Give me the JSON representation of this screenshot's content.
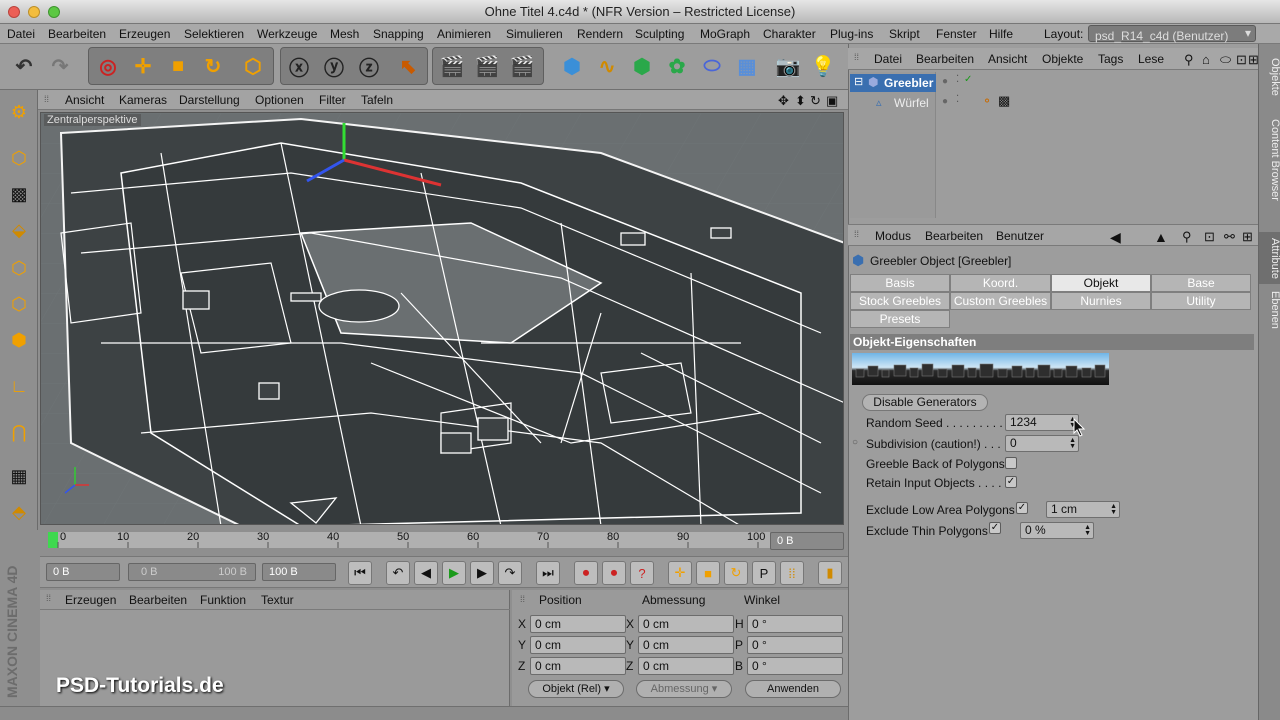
{
  "window": {
    "title": "Ohne Titel 4.c4d * (NFR Version – Restricted License)"
  },
  "menubar": {
    "items": [
      "Datei",
      "Bearbeiten",
      "Erzeugen",
      "Selektieren",
      "Werkzeuge",
      "Mesh",
      "Snapping",
      "Animieren",
      "Simulieren",
      "Rendern",
      "Sculpting",
      "MoGraph",
      "Charakter",
      "Plug-ins",
      "Skript",
      "Fenster",
      "Hilfe"
    ],
    "layout_label": "Layout:",
    "layout_value": "psd_R14_c4d (Benutzer)"
  },
  "viewport": {
    "menu": [
      "Ansicht",
      "Kameras",
      "Darstellung",
      "Optionen",
      "Filter",
      "Tafeln"
    ],
    "label": "Zentralperspektive"
  },
  "timeline": {
    "ticks": [
      "0",
      "10",
      "20",
      "30",
      "40",
      "50",
      "60",
      "70",
      "80",
      "90",
      "100"
    ],
    "current_frame_field": "0 B"
  },
  "transport": {
    "start_field": "0 B",
    "range_start": "0 B",
    "range_end": "100 B",
    "end_field": "100 B"
  },
  "material_panel": {
    "menu": [
      "Erzeugen",
      "Bearbeiten",
      "Funktion",
      "Textur"
    ]
  },
  "coord_panel": {
    "headers": [
      "Position",
      "Abmessung",
      "Winkel"
    ],
    "pos": {
      "x": "0 cm",
      "y": "0 cm",
      "z": "0 cm"
    },
    "size": {
      "x": "0 cm",
      "y": "0 cm",
      "z": "0 cm"
    },
    "rot": {
      "h": "0 °",
      "p": "0 °",
      "b": "0 °"
    },
    "axis_labels": {
      "x": "X",
      "y": "Y",
      "z": "Z",
      "h": "H",
      "p": "P",
      "b": "B"
    },
    "mode_select": "Objekt (Rel)",
    "size_select": "Abmessung",
    "apply_button": "Anwenden"
  },
  "branding": {
    "watermark": "PSD-Tutorials.de",
    "maxon": "MAXON CINEMA 4D"
  },
  "object_manager": {
    "menu": [
      "Datei",
      "Bearbeiten",
      "Ansicht",
      "Objekte",
      "Tags",
      "Lese"
    ],
    "objects": [
      {
        "name": "Greebler"
      },
      {
        "name": "Würfel"
      }
    ]
  },
  "attribute_manager": {
    "menu": [
      "Modus",
      "Bearbeiten",
      "Benutzer"
    ],
    "object_title": "Greebler Object [Greebler]",
    "tabs_row1": [
      "Basis",
      "Koord.",
      "Objekt",
      "Base"
    ],
    "tabs_row2": [
      "Stock Greebles",
      "Custom Greebles",
      "Nurnies",
      "Utility"
    ],
    "tabs_row3": [
      "Presets"
    ],
    "active_tab": "Objekt",
    "section_title": "Objekt-Eigenschaften",
    "disable_generators": "Disable Generators",
    "params": {
      "random_seed_label": "Random Seed . . . . . . . . . .",
      "random_seed_value": "1234",
      "subdivision_label": "Subdivision (caution!) . . .",
      "subdivision_value": "0",
      "greeble_back_label": "Greeble Back of Polygons",
      "greeble_back_checked": false,
      "retain_input_label": "Retain Input Objects . . . .",
      "retain_input_checked": true,
      "exclude_low_label": "Exclude Low Area Polygons",
      "exclude_low_value": "1 cm",
      "exclude_thin_label": "Exclude Thin Polygons",
      "exclude_thin_value": "0 %"
    }
  },
  "side_tabs": [
    "Objekte",
    "Content Browser",
    "Attribute",
    "Ebenen"
  ],
  "colors": {
    "accent_blue": "#3a6fb0",
    "active_tab": "#e8e8e8"
  }
}
